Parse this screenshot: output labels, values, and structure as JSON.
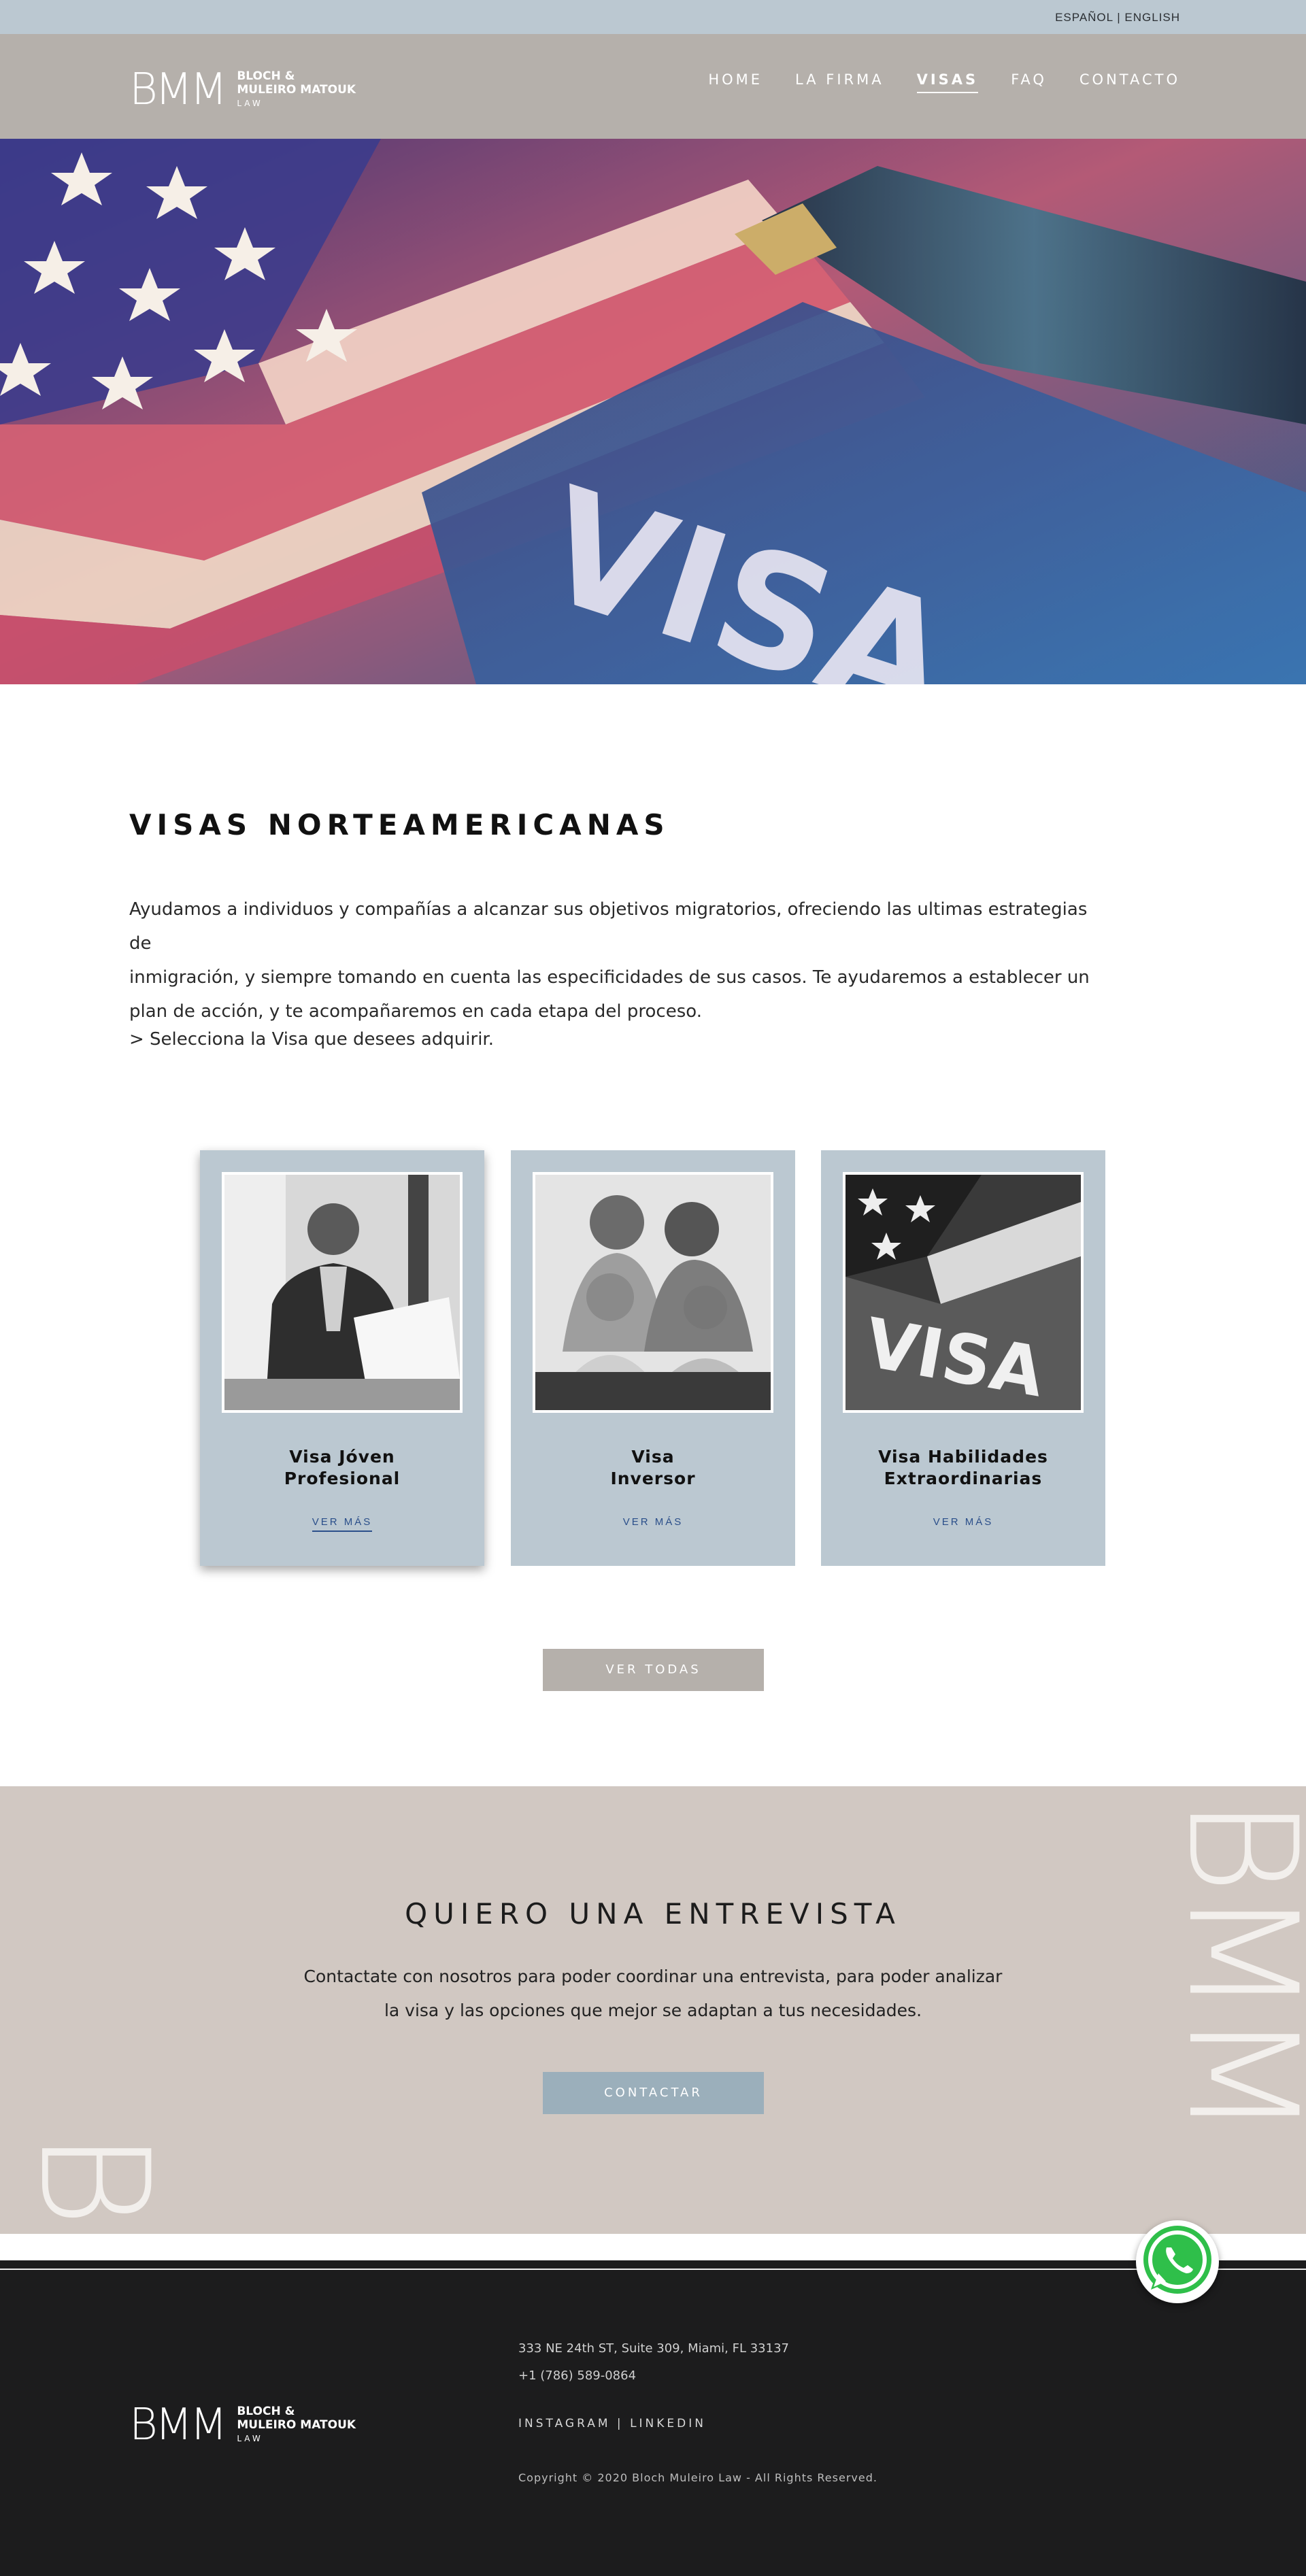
{
  "language_bar": {
    "espanol": "ESPAÑOL",
    "separator": " | ",
    "english": "ENGLISH"
  },
  "brand": {
    "mark": "BMM",
    "line1": "BLOCH &",
    "line2": "MULEIRO MATOUK",
    "line3": "LAW"
  },
  "nav": {
    "items": [
      "HOME",
      "LA FIRMA",
      "VISAS",
      "FAQ",
      "CONTACTO"
    ],
    "active": "VISAS"
  },
  "hero": {
    "image": "american-flag-visa-photo",
    "overlay_text": "VISA"
  },
  "intro": {
    "title": "VISAS NORTEAMERICANAS",
    "text_line1": "Ayudamos a individuos y compañías a alcanzar sus objetivos migratorios, ofreciendo las ultimas estrategias de",
    "text_line2": "inmigración, y siempre tomando en cuenta las especificidades de sus casos. Te ayudaremos a establecer un",
    "text_line3": "plan de acción, y te acompañaremos en cada etapa del proceso.",
    "hint": "> Selecciona la Visa que desees adquirir."
  },
  "cards": [
    {
      "title_line1": "Visa Jóven",
      "title_line2": "Profesional",
      "link": "VER MÁS",
      "image": "professional-man-reading-photo"
    },
    {
      "title_line1": "Visa",
      "title_line2": "Inversor",
      "link": "VER MÁS",
      "image": "family-portrait-photo"
    },
    {
      "title_line1": "Visa Habilidades",
      "title_line2": "Extraordinarias",
      "link": "VER MÁS",
      "image": "visa-document-photo"
    }
  ],
  "view_all": "VER TODAS",
  "contact_band": {
    "title": "QUIERO UNA ENTREVISTA",
    "text_line1": "Contactate con nosotros para poder coordinar una entrevista, para poder analizar",
    "text_line2": "la visa y las opciones que mejor se adaptan a tus necesidades.",
    "button": "CONTACTAR",
    "watermark": "BMM"
  },
  "footer": {
    "address": "333 NE 24th ST, Suite 309, Miami, FL 33137",
    "phone": "+1 (786) 589-0864",
    "instagram": "INSTAGRAM",
    "separator": " | ",
    "linkedin": "LINKEDIN",
    "copyright": "Copyright © 2020 Bloch Muleiro Law - All Rights Reserved."
  },
  "colors": {
    "lang_bar": "#bbc8d1",
    "header": "#b5b0ab",
    "card": "#bbc8d1",
    "band": "#d1c8c2",
    "footer": "#1c1c1d",
    "contact_button": "#9bafbb",
    "link": "#2b4f8a"
  },
  "whatsapp": {
    "icon": "whatsapp-icon"
  }
}
